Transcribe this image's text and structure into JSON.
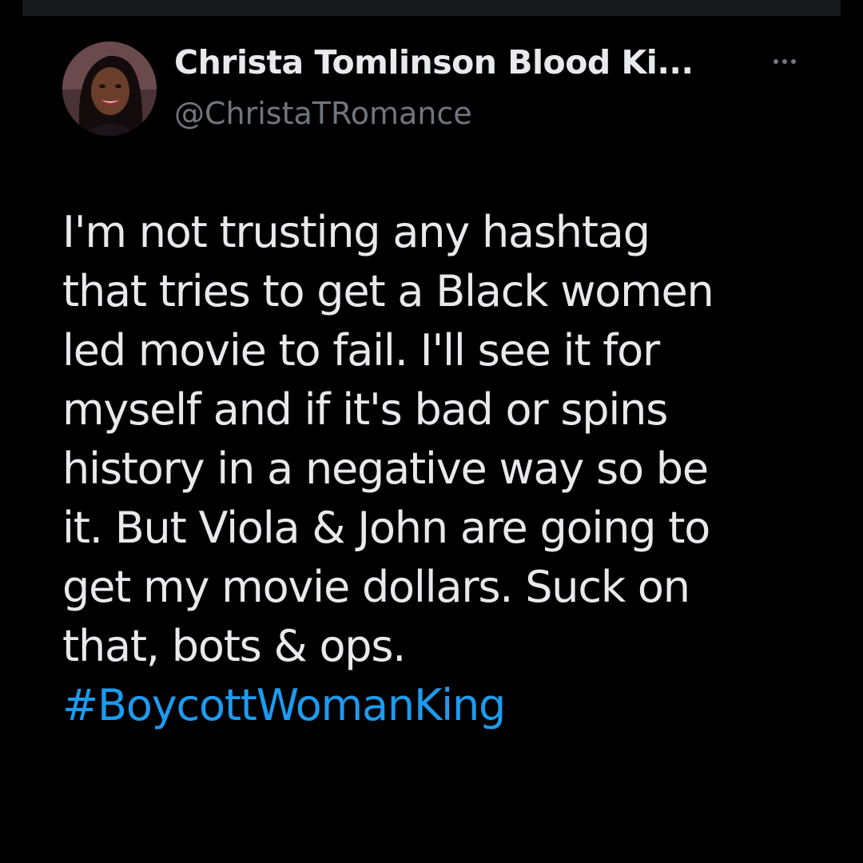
{
  "author": {
    "display_name": "Christa Tomlinson Blood Ki...",
    "handle": "@ChristaTRomance"
  },
  "menu": {
    "icon": "more-horizontal-icon"
  },
  "tweet": {
    "lines": [
      "I'm not trusting any hashtag",
      "that tries to get a Black women",
      "led movie to fail. I'll see it for",
      "myself and if it's bad or spins",
      "history in a negative way so be",
      "it. But Viola & John are going to",
      "get my movie dollars. Suck on",
      "that, bots & ops."
    ],
    "hashtag": "#BoycottWomanKing"
  },
  "colors": {
    "background": "#000000",
    "text": "#e7e9ea",
    "secondary_text": "#71767b",
    "link": "#1d9bf0"
  }
}
